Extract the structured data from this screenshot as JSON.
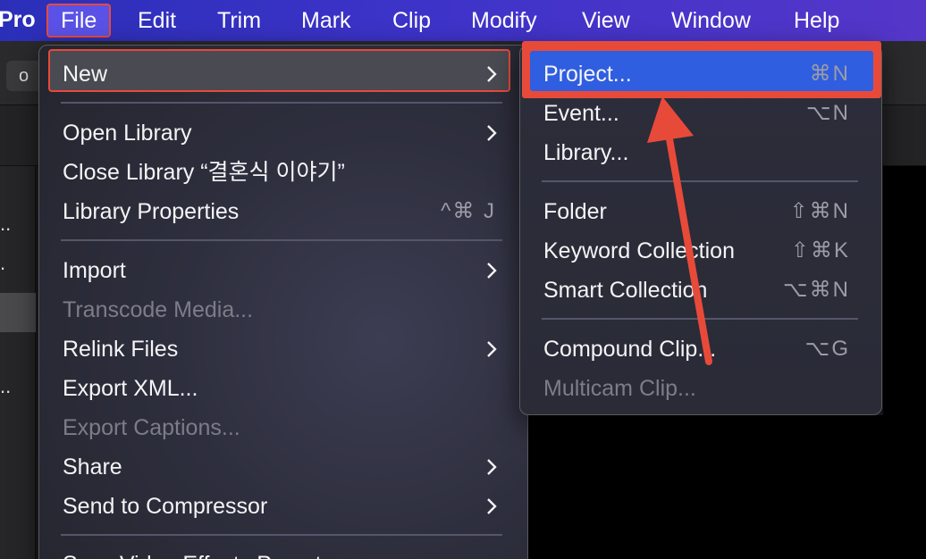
{
  "menubar": {
    "app_name": "Pro",
    "items": [
      "File",
      "Edit",
      "Trim",
      "Mark",
      "Clip",
      "Modify",
      "View",
      "Window",
      "Help"
    ]
  },
  "file_menu": {
    "new": "New",
    "open_library": "Open Library",
    "close_library": "Close Library “결혼식 이야기”",
    "library_properties": "Library Properties",
    "library_properties_shortcut": "^⌘ J",
    "import": "Import",
    "transcode_media": "Transcode Media...",
    "relink_files": "Relink Files",
    "export_xml": "Export XML...",
    "export_captions": "Export Captions...",
    "share": "Share",
    "send_to_compressor": "Send to Compressor",
    "partial_next": "Save Video Effects Preset..."
  },
  "new_submenu": {
    "project": "Project...",
    "project_shortcut": "⌘N",
    "event": "Event...",
    "event_shortcut": "⌥N",
    "library": "Library...",
    "folder": "Folder",
    "folder_shortcut": "⇧⌘N",
    "keyword_collection": "Keyword Collection",
    "keyword_collection_shortcut": "⇧⌘K",
    "smart_collection": "Smart Collection",
    "smart_collection_shortcut": "⌥⌘N",
    "compound_clip": "Compound Clip...",
    "compound_clip_shortcut": "⌥G",
    "multicam_clip": "Multicam Clip..."
  },
  "background": {
    "toolbar_glyph": "o",
    "side_dots": [
      "..",
      ".",
      "..",
      ".."
    ]
  },
  "colors": {
    "highlight": "#e84a3a",
    "selection": "#2f5ee0",
    "menubar": "#3d33c9"
  }
}
